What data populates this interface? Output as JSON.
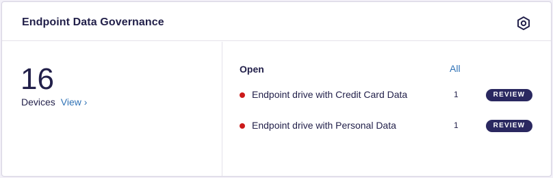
{
  "card": {
    "title": "Endpoint Data Governance",
    "settings_icon": "gear-hex-icon"
  },
  "summary": {
    "device_count": "16",
    "devices_label": "Devices",
    "view_link": "View ›"
  },
  "issues": {
    "heading": "Open",
    "all_link": "All",
    "items": [
      {
        "label": "Endpoint drive with Credit Card Data",
        "count": "1",
        "action": "REVIEW",
        "status_color": "#cc1a1a"
      },
      {
        "label": "Endpoint drive with Personal Data",
        "count": "1",
        "action": "REVIEW",
        "status_color": "#cc1a1a"
      }
    ]
  },
  "colors": {
    "accent": "#2a2860",
    "link": "#2f72b6",
    "text": "#22204a"
  }
}
